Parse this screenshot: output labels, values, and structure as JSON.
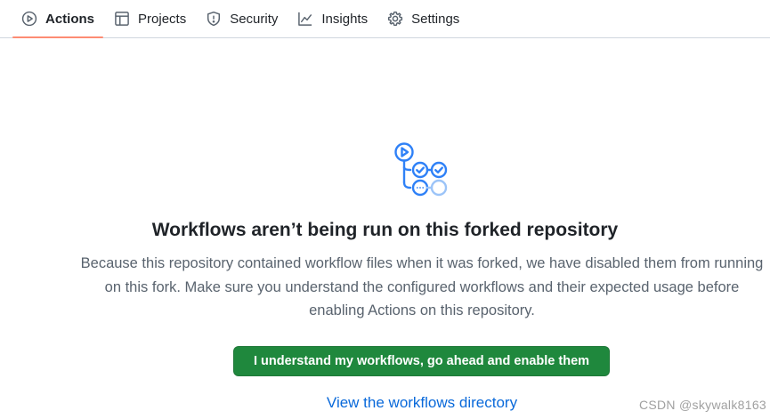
{
  "tabs": [
    {
      "label": "Actions",
      "icon": "play-icon",
      "active": true
    },
    {
      "label": "Projects",
      "icon": "table-icon",
      "active": false
    },
    {
      "label": "Security",
      "icon": "shield-icon",
      "active": false
    },
    {
      "label": "Insights",
      "icon": "graph-icon",
      "active": false
    },
    {
      "label": "Settings",
      "icon": "gear-icon",
      "active": false
    }
  ],
  "empty_state": {
    "icon": "workflow-icon",
    "title": "Workflows aren’t being run on this forked repository",
    "description": "Because this repository contained workflow files when it was forked, we have disabled them from running on this fork. Make sure you understand the configured workflows and their expected usage before enabling Actions on this repository.",
    "enable_button": "I understand my workflows, go ahead and enable them",
    "view_link": "View the workflows directory"
  },
  "watermark": "CSDN @skywalk8163",
  "colors": {
    "accent_underline": "#fd8c73",
    "button_green": "#1f883d",
    "link_blue": "#0969da",
    "icon_blue": "#2f81f7"
  }
}
